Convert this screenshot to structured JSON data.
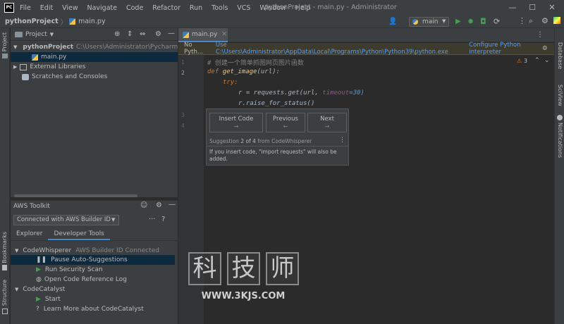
{
  "titlebar": {
    "logo": "PC",
    "menus": [
      "File",
      "Edit",
      "View",
      "Navigate",
      "Code",
      "Refactor",
      "Run",
      "Tools",
      "VCS",
      "Window",
      "Help"
    ],
    "title": "pythonProject - main.py - Administrator",
    "minimize_glyph": "—",
    "maximize_glyph": "☐",
    "close_glyph": "✕"
  },
  "navbar": {
    "project": "pythonProject",
    "separator": "〉",
    "file": "main.py",
    "branch": "main",
    "icons": [
      "user-icon",
      "run-icon",
      "debug-icon",
      "coverage-icon",
      "profile-icon",
      "more-icon",
      "search-icon",
      "settings-icon",
      "jetbrains-icon"
    ]
  },
  "left_stripe": {
    "top_label": "Project",
    "bookmarks_label": "Bookmarks",
    "structure_label": "Structure"
  },
  "right_stripe": {
    "database_label": "Database",
    "sciview_label": "SciView",
    "notifications_label": "Notifications"
  },
  "project_panel": {
    "title": "Project",
    "tree": [
      {
        "label": "pythonProject",
        "path": "C:\\Users\\Administrator\\PycharmProj",
        "type": "folder"
      },
      {
        "label": "main.py",
        "type": "pyfile",
        "selected": true
      },
      {
        "label": "External Libraries",
        "type": "lib"
      },
      {
        "label": "Scratches and Consoles",
        "type": "scratch"
      }
    ]
  },
  "aws_panel": {
    "title": "AWS Toolkit",
    "connection": "Connected with AWS Builder ID",
    "tabs": [
      "Explorer",
      "Developer Tools"
    ],
    "active_tab": "Developer Tools",
    "codewhisperer": {
      "label": "CodeWhisperer",
      "status": "AWS Builder ID Connected"
    },
    "items": [
      "Pause Auto-Suggestions",
      "Run Security Scan",
      "Open Code Reference Log"
    ],
    "codecatalyst": {
      "label": "CodeCatalyst",
      "items": [
        "Start",
        "Learn More about CodeCatalyst"
      ]
    }
  },
  "editor": {
    "tab_label": "main.py",
    "banner_prefix": "No Pyth...",
    "banner_text": "Use C:\\Users\\Administrator\\AppData\\Local\\Programs\\Python\\Python39\\python.exe",
    "banner_link": "Configure Python interpreter",
    "warning_count": "3",
    "lines": {
      "n1": "1",
      "n2": "2",
      "n3": "3",
      "n4": "4",
      "comment": "# 创建一个简单抓图网页图片函数",
      "def": "def",
      "fname": "get_image",
      "arg": "(url):",
      "try": "try:",
      "r_assign": "r = requests.get(url,",
      "timeout_kw": "timeout",
      "timeout_val": "=30)",
      "raise": "r.raise_for_status()"
    },
    "popup": {
      "insert": "Insert Code",
      "insert_arrow": "→",
      "previous": "Previous",
      "previous_arrow": "←",
      "next": "Next",
      "next_arrow": "→",
      "meta_prefix": "Suggestion",
      "meta_index": "2 of 4",
      "meta_suffix": "from CodeWhisperer",
      "note": "If you insert code, \"import requests\" will also be added."
    }
  },
  "watermark": {
    "chars": [
      "科",
      "技",
      "师"
    ],
    "url": "WWW.3KJS.COM"
  },
  "colors": {
    "accent": "#4a88c7",
    "run_green": "#499c54",
    "selection": "#0d293e"
  }
}
